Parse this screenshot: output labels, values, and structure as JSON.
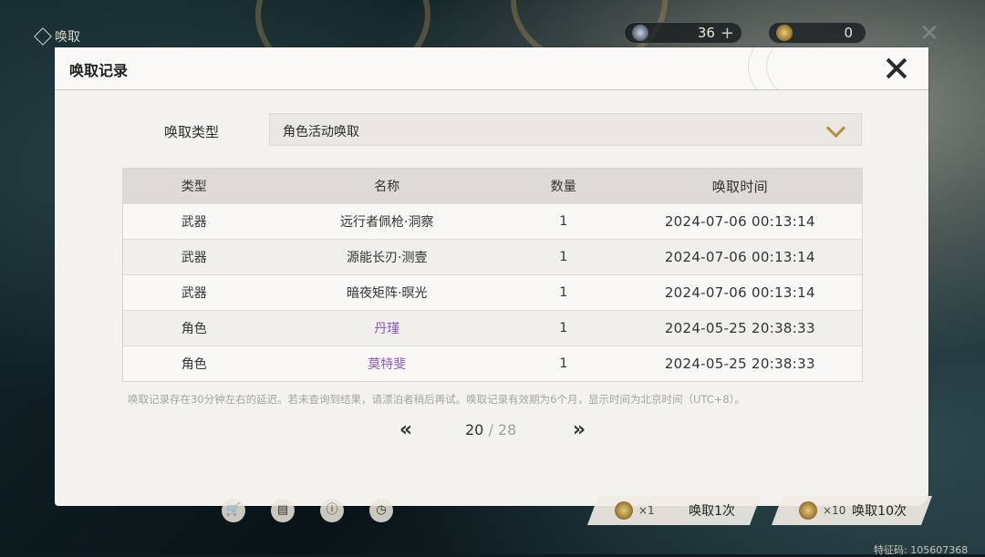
{
  "topbar": {
    "title": "唤取",
    "currencies": [
      {
        "icon": "astrite-icon",
        "value": "36",
        "plus": "+"
      },
      {
        "icon": "coin-icon",
        "value": "0"
      }
    ]
  },
  "modal": {
    "title": "唤取记录",
    "filter": {
      "label": "唤取类型",
      "selected": "角色活动唤取"
    },
    "table": {
      "headers": [
        "类型",
        "名称",
        "数量",
        "唤取时间"
      ],
      "rows": [
        {
          "type": "武器",
          "name": "远行者佩枪·洞察",
          "qty": "1",
          "time": "2024-07-06 00:13:14",
          "highlight": false
        },
        {
          "type": "武器",
          "name": "源能长刃·测壹",
          "qty": "1",
          "time": "2024-07-06 00:13:14",
          "highlight": false
        },
        {
          "type": "武器",
          "name": "暗夜矩阵·暝光",
          "qty": "1",
          "time": "2024-07-06 00:13:14",
          "highlight": false
        },
        {
          "type": "角色",
          "name": "丹瑾",
          "qty": "1",
          "time": "2024-05-25 20:38:33",
          "highlight": true
        },
        {
          "type": "角色",
          "name": "莫特斐",
          "qty": "1",
          "time": "2024-05-25 20:38:33",
          "highlight": true
        }
      ]
    },
    "note": "唤取记录存在30分钟左右的延迟。若未查询到结果，请漂泊者稍后再试。唤取记录有效期为6个月，显示时间为北京时间（UTC+8）。",
    "pager": {
      "current": "20",
      "separator": " / ",
      "total": "28",
      "prev": "«",
      "next": "»"
    }
  },
  "bottom": {
    "pull_one": {
      "mult": "×1",
      "label": "唤取1次"
    },
    "pull_ten": {
      "mult": "×10",
      "label": "唤取10次"
    },
    "uid": "特征码: 105607368"
  },
  "colors": {
    "accent": "#b88c3c",
    "highlight_name": "#8c5ab8"
  }
}
